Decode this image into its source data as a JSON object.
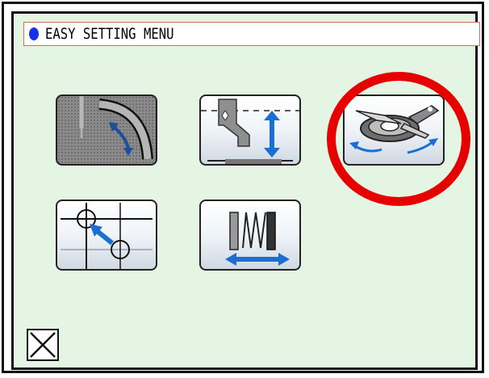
{
  "window": {
    "title": "EASY SETTING MENU",
    "indicator_color": "#1a2fe8"
  },
  "buttons": [
    {
      "icon": "needle-arc-icon",
      "state": "disabled"
    },
    {
      "icon": "presser-foot-height-icon",
      "state": "enabled"
    },
    {
      "icon": "thread-trimmer-knife-icon",
      "state": "enabled",
      "highlighted": true
    },
    {
      "icon": "origin-shift-icon",
      "state": "enabled"
    },
    {
      "icon": "thread-tension-spring-icon",
      "state": "enabled"
    }
  ],
  "close_button": {
    "icon": "close-x-icon"
  },
  "highlight": {
    "color": "#e60000",
    "target": "thread-trimmer-knife-icon"
  },
  "colors": {
    "screen_bg": "#e4f5e4",
    "accent_blue": "#1a6fd0"
  }
}
